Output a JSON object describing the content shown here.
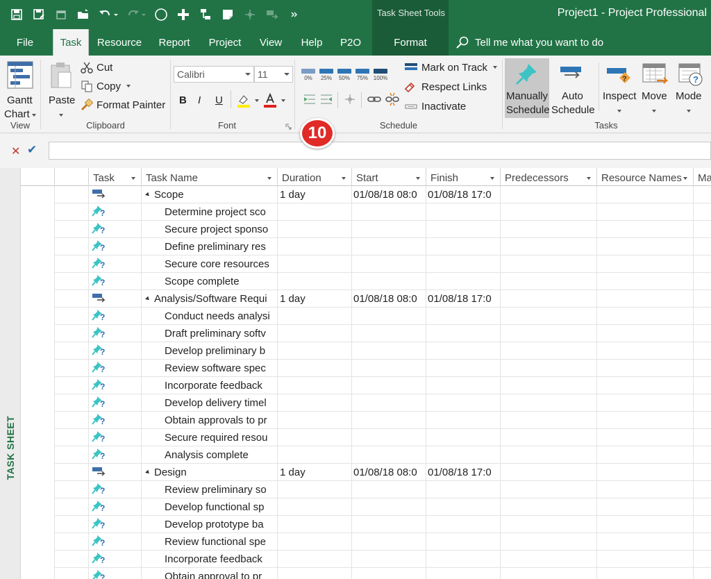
{
  "window": {
    "context_tool_label": "Task Sheet Tools",
    "title": "Project1  -  Project Professional"
  },
  "tabs": [
    {
      "label": "File"
    },
    {
      "label": "Task",
      "active": true
    },
    {
      "label": "Resource"
    },
    {
      "label": "Report"
    },
    {
      "label": "Project"
    },
    {
      "label": "View"
    },
    {
      "label": "Help"
    },
    {
      "label": "P2O"
    },
    {
      "label": "Format",
      "context": true
    }
  ],
  "tell_me": "Tell me what you want to do",
  "ribbon": {
    "view": {
      "gantt_label_1": "Gantt",
      "gantt_label_2": "Chart",
      "group": "View"
    },
    "clipboard": {
      "paste": "Paste",
      "cut": "Cut",
      "copy": "Copy",
      "format_painter": "Format Painter",
      "group": "Clipboard"
    },
    "font": {
      "family": "Calibri",
      "size": "11",
      "bold": "B",
      "italic": "I",
      "underline": "U",
      "group": "Font"
    },
    "schedule": {
      "percent_buttons": [
        "0%",
        "25%",
        "50%",
        "75%",
        "100%"
      ],
      "mark_on_track": "Mark on Track",
      "respect_links": "Respect Links",
      "inactivate": "Inactivate",
      "group": "Schedule"
    },
    "tasks": {
      "manually_1": "Manually",
      "manually_2": "Schedule",
      "auto_1": "Auto",
      "auto_2": "Schedule",
      "inspect": "Inspect",
      "move": "Move",
      "mode": "Mode",
      "group": "Tasks"
    },
    "callout_number": "10"
  },
  "side_label": "TASK SHEET",
  "columns": [
    "Task",
    "Task Name",
    "Duration",
    "Start",
    "Finish",
    "Predecessors",
    "Resource Names",
    "Ma"
  ],
  "rows": [
    {
      "summary": true,
      "name": "Scope",
      "duration": "1 day",
      "start": "01/08/18 08:0",
      "finish": "01/08/18 17:0"
    },
    {
      "summary": false,
      "name": "Determine project sco",
      "duration": "",
      "start": "",
      "finish": ""
    },
    {
      "summary": false,
      "name": "Secure project sponso",
      "duration": "",
      "start": "",
      "finish": ""
    },
    {
      "summary": false,
      "name": "Define preliminary res",
      "duration": "",
      "start": "",
      "finish": ""
    },
    {
      "summary": false,
      "name": "Secure core resources",
      "duration": "",
      "start": "",
      "finish": ""
    },
    {
      "summary": false,
      "name": "Scope complete",
      "duration": "",
      "start": "",
      "finish": ""
    },
    {
      "summary": true,
      "name": "Analysis/Software Requi",
      "duration": "1 day",
      "start": "01/08/18 08:0",
      "finish": "01/08/18 17:0"
    },
    {
      "summary": false,
      "name": "Conduct needs analysi",
      "duration": "",
      "start": "",
      "finish": ""
    },
    {
      "summary": false,
      "name": "Draft preliminary softv",
      "duration": "",
      "start": "",
      "finish": ""
    },
    {
      "summary": false,
      "name": "Develop preliminary b",
      "duration": "",
      "start": "",
      "finish": ""
    },
    {
      "summary": false,
      "name": "Review software spec",
      "duration": "",
      "start": "",
      "finish": ""
    },
    {
      "summary": false,
      "name": "Incorporate feedback",
      "duration": "",
      "start": "",
      "finish": ""
    },
    {
      "summary": false,
      "name": "Develop delivery timel",
      "duration": "",
      "start": "",
      "finish": ""
    },
    {
      "summary": false,
      "name": "Obtain approvals to pr",
      "duration": "",
      "start": "",
      "finish": ""
    },
    {
      "summary": false,
      "name": "Secure required resou",
      "duration": "",
      "start": "",
      "finish": ""
    },
    {
      "summary": false,
      "name": "Analysis complete",
      "duration": "",
      "start": "",
      "finish": ""
    },
    {
      "summary": true,
      "name": "Design",
      "duration": "1 day",
      "start": "01/08/18 08:0",
      "finish": "01/08/18 17:0"
    },
    {
      "summary": false,
      "name": "Review preliminary so",
      "duration": "",
      "start": "",
      "finish": ""
    },
    {
      "summary": false,
      "name": "Develop functional sp",
      "duration": "",
      "start": "",
      "finish": ""
    },
    {
      "summary": false,
      "name": "Develop prototype ba",
      "duration": "",
      "start": "",
      "finish": ""
    },
    {
      "summary": false,
      "name": "Review functional spe",
      "duration": "",
      "start": "",
      "finish": ""
    },
    {
      "summary": false,
      "name": "Incorporate feedback",
      "duration": "",
      "start": "",
      "finish": ""
    },
    {
      "summary": false,
      "name": "Obtain approval to pr",
      "duration": "",
      "start": "",
      "finish": ""
    }
  ],
  "colors": {
    "accent": "#217346",
    "context": "#1a5c38",
    "callout": "#e02b27"
  }
}
